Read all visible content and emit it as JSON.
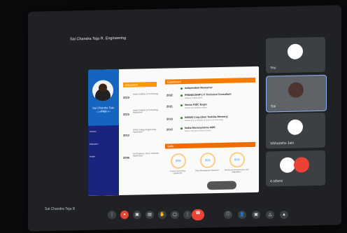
{
  "meeting": {
    "title": "Sai Chandra Teja R. Engineering",
    "footer_name": "Sai Chandra Teja R",
    "participants": [
      {
        "name": "You"
      },
      {
        "name": "Sai"
      },
      {
        "name": "Vibhanshu Jain"
      },
      {
        "name": "4 others"
      }
    ]
  },
  "slide": {
    "person_name": "Sai Chandra Teja, PhD",
    "person_sub": "Chief Scientist",
    "side_blocks": [
      "Contact",
      "Education",
      "Profile"
    ],
    "section_titles": {
      "education": "Education",
      "experience": "Experience",
      "skills": "Skills"
    },
    "education": [
      {
        "year": "2019",
        "text": "Indian Institute of Technology"
      },
      {
        "year": "2015",
        "text": "Indian Institute of Technology Hyderabad"
      },
      {
        "year": "2010",
        "text": "NITW College Engineering Hyderabad"
      },
      {
        "year": "2006",
        "text": "Sri Chaitanya Junior Kalasala Hyderabad"
      }
    ],
    "experience": [
      {
        "year": "2022",
        "title": "Independent Researcer",
        "sub": ""
      },
      {
        "year": "2021",
        "title": "PRENEUSHIP | IT Technical Consultant",
        "sub": "Industry Collaboration"
      },
      {
        "year": "2021",
        "title": "Senior RISC Engin",
        "sub": "Design and Building Leader"
      },
      {
        "year": "2016",
        "title": "NISSIN Corp.(then Toshiba Memory)",
        "sub": "Researcher at Institute of Science & Technology"
      },
      {
        "year": "2015",
        "title": "Nokia Microsystems AMS",
        "sub": "Intern / Research Center Europe"
      }
    ],
    "skills": [
      {
        "pct": "90%",
        "label": "Product Technology Leadership"
      },
      {
        "pct": "95%",
        "label": "Team Management Research"
      },
      {
        "pct": "85%",
        "label": "Technical Communication and Negotiation"
      }
    ]
  },
  "colors": {
    "accent_orange": "#f57c00",
    "slide_blue": "#1565c0",
    "end_call_red": "#ea4335"
  }
}
